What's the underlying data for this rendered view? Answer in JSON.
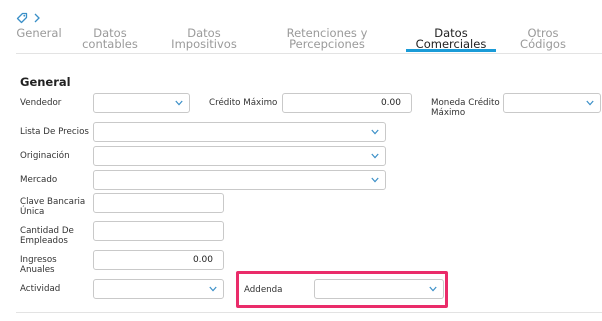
{
  "tabs": [
    {
      "label": "General"
    },
    {
      "label": "Datos contables"
    },
    {
      "label": "Datos Impositivos"
    },
    {
      "label": "Retenciones y Percepciones"
    },
    {
      "label": "Datos Comerciales",
      "active": true
    },
    {
      "label": "Otros Códigos"
    }
  ],
  "section": {
    "title": "General"
  },
  "fields": {
    "vendedor": {
      "label": "Vendedor",
      "value": ""
    },
    "credito_maximo": {
      "label": "Crédito Máximo",
      "value": "0.00"
    },
    "moneda_credito_maximo": {
      "label": "Moneda Crédito Máximo",
      "value": ""
    },
    "lista_de_precios": {
      "label": "Lista De Precios",
      "value": ""
    },
    "originacion": {
      "label": "Originación",
      "value": ""
    },
    "mercado": {
      "label": "Mercado",
      "value": ""
    },
    "clave_bancaria_unica": {
      "label": "Clave Bancaria Única",
      "value": ""
    },
    "cantidad_de_empleados": {
      "label": "Cantidad De Empleados",
      "value": ""
    },
    "ingresos_anuales": {
      "label": "Ingresos Anuales",
      "value": "0.00"
    },
    "actividad": {
      "label": "Actividad",
      "value": ""
    },
    "addenda": {
      "label": "Addenda",
      "value": ""
    }
  },
  "colors": {
    "accent": "#1a9bd7",
    "highlight": "#ea2c6a",
    "chevron": "#3a8fc7"
  },
  "icons": [
    "tag-icon",
    "chevron-right-icon",
    "chevron-down-icon"
  ]
}
